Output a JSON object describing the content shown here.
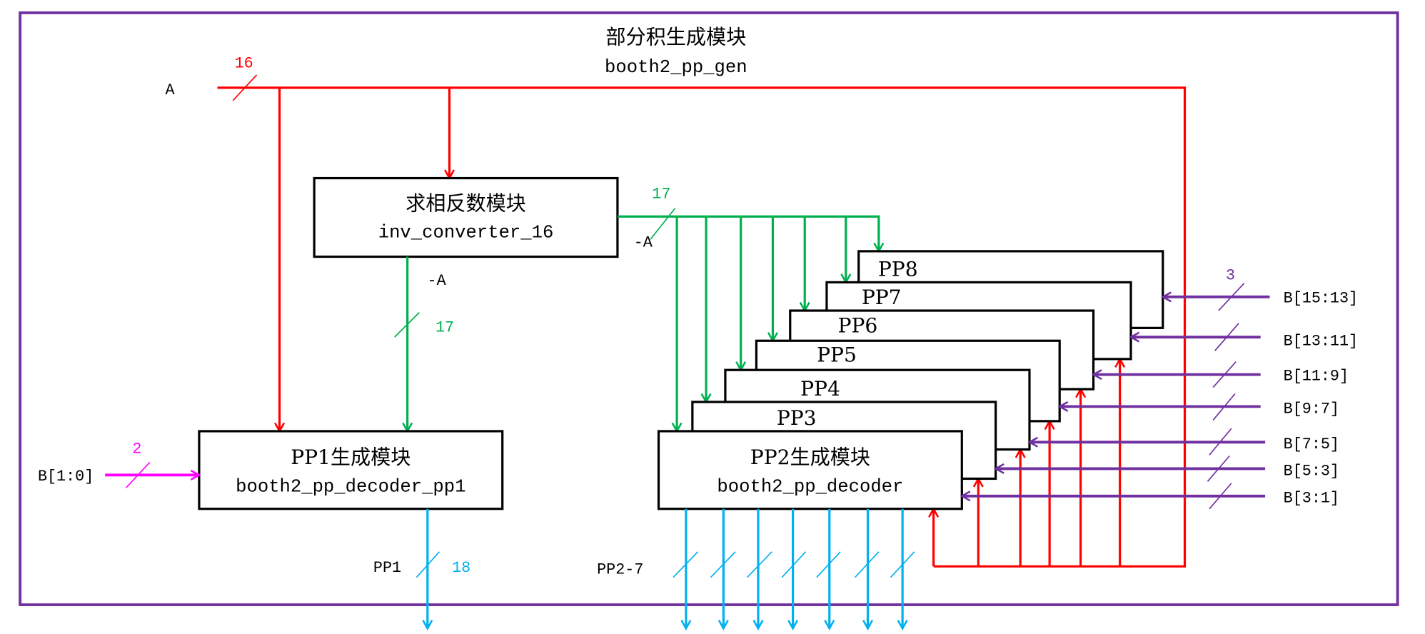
{
  "module": {
    "title_cn": "部分积生成模块",
    "title_en": "booth2_pp_gen"
  },
  "inputs": {
    "a": {
      "label": "A",
      "width": "16"
    },
    "b10": {
      "label": "B[1:0]",
      "width": "2"
    },
    "b_groups": [
      "B[15:13]",
      "B[13:11]",
      "B[11:9]",
      "B[9:7]",
      "B[7:5]",
      "B[5:3]",
      "B[3:1]"
    ],
    "b_width": "3"
  },
  "inv": {
    "title_cn": "求相反数模块",
    "title_en": "inv_converter_16",
    "out_label": "-A",
    "out_width": "17"
  },
  "pp1": {
    "title_cn": "PP1生成模块",
    "title_en": "booth2_pp_decoder_pp1",
    "out_label": "PP1",
    "out_width": "18"
  },
  "pp2": {
    "title_cn": "PP2生成模块",
    "title_en": "booth2_pp_decoder",
    "out_label": "PP2-7"
  },
  "stack": [
    "PP3",
    "PP4",
    "PP5",
    "PP6",
    "PP7",
    "PP8"
  ],
  "colors": {
    "a": "#ff0000",
    "neg_a": "#00b050",
    "b": "#7030a0",
    "b10": "#ff00ff",
    "pp": "#00b0f0",
    "frame": "#7030a0"
  }
}
